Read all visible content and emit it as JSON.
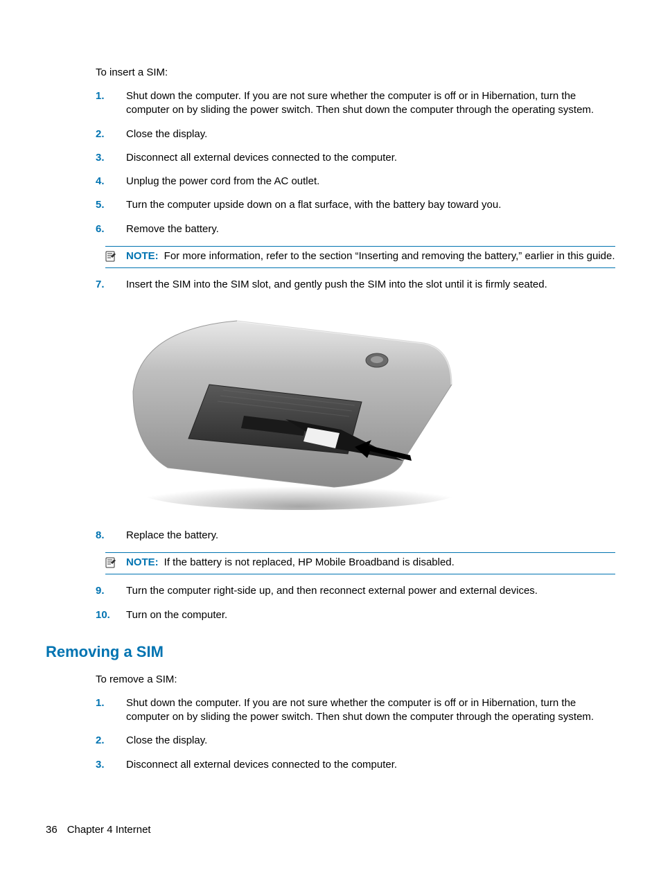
{
  "intro1": "To insert a SIM:",
  "steps1": {
    "s1": "Shut down the computer. If you are not sure whether the computer is off or in Hibernation, turn the computer on by sliding the power switch. Then shut down the computer through the operating system.",
    "s2": "Close the display.",
    "s3": "Disconnect all external devices connected to the computer.",
    "s4": "Unplug the power cord from the AC outlet.",
    "s5": "Turn the computer upside down on a flat surface, with the battery bay toward you.",
    "s6": "Remove the battery.",
    "s7": "Insert the SIM into the SIM slot, and gently push the SIM into the slot until it is firmly seated.",
    "s8": "Replace the battery.",
    "s9": "Turn the computer right-side up, and then reconnect external power and external devices.",
    "s10": "Turn on the computer."
  },
  "note1_label": "NOTE:",
  "note1_text": "For more information, refer to the section “Inserting and removing the battery,” earlier in this guide.",
  "note2_label": "NOTE:",
  "note2_text": "If the battery is not replaced, HP Mobile Broadband is disabled.",
  "heading2": "Removing a SIM",
  "intro2": "To remove a SIM:",
  "steps2": {
    "s1": "Shut down the computer. If you are not sure whether the computer is off or in Hibernation, turn the computer on by sliding the power switch. Then shut down the computer through the operating system.",
    "s2": "Close the display.",
    "s3": "Disconnect all external devices connected to the computer."
  },
  "footer": {
    "page": "36",
    "chapter": "Chapter 4   Internet"
  },
  "nums": {
    "n1": "1.",
    "n2": "2.",
    "n3": "3.",
    "n4": "4.",
    "n5": "5.",
    "n6": "6.",
    "n7": "7.",
    "n8": "8.",
    "n9": "9.",
    "n10": "10."
  }
}
